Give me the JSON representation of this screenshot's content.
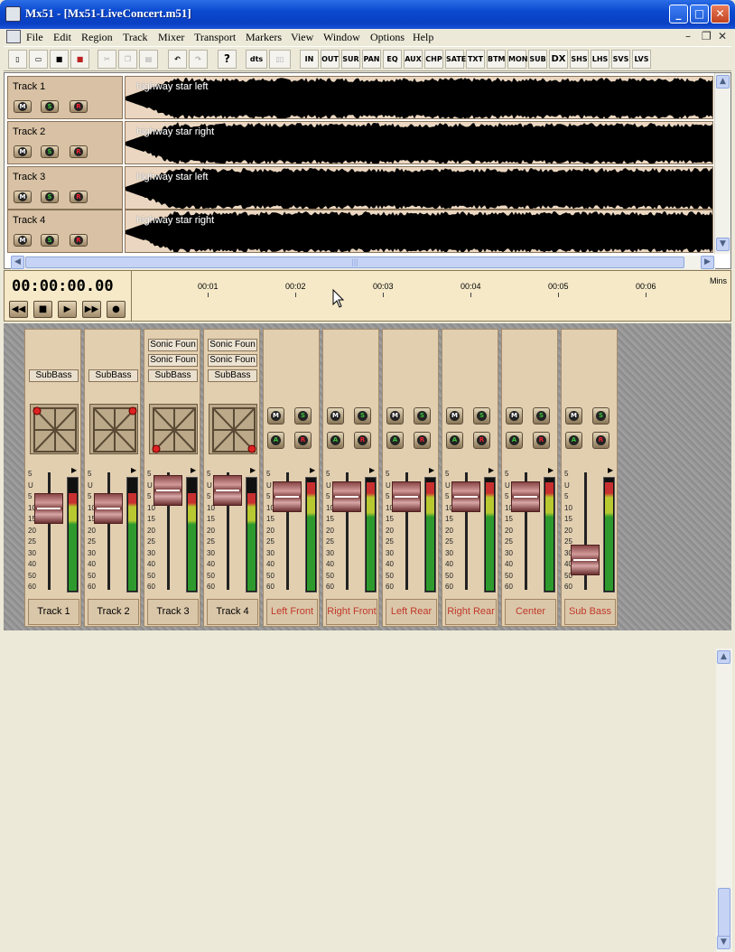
{
  "window": {
    "title": "Mx51 - [Mx51-LiveConcert.m51]"
  },
  "menu": [
    "File",
    "Edit",
    "Region",
    "Track",
    "Mixer",
    "Transport",
    "Markers",
    "View",
    "Window",
    "Options",
    "Help"
  ],
  "toolbar": {
    "buttons": [
      "new",
      "open",
      "save",
      "save-as",
      "cut",
      "copy",
      "paste",
      "undo",
      "redo",
      "help"
    ],
    "dts": "dts",
    "mixer_buttons": [
      "IN",
      "OUT",
      "SUR",
      "PAN",
      "EQ",
      "AUX",
      "CHP",
      "SATE",
      "TXT",
      "BTM",
      "MON",
      "SUB",
      "DX",
      "SHS",
      "LHS",
      "SVS",
      "LVS"
    ]
  },
  "tracks": [
    {
      "name": "Track 1",
      "clip": "highway star left",
      "buttons": {
        "m": "M",
        "s": "S",
        "r": "R"
      }
    },
    {
      "name": "Track 2",
      "clip": "highway star right",
      "buttons": {
        "m": "M",
        "s": "S",
        "r": "R"
      }
    },
    {
      "name": "Track 3",
      "clip": "highway star left",
      "buttons": {
        "m": "M",
        "s": "S",
        "r": "R"
      }
    },
    {
      "name": "Track 4",
      "clip": "highway star right",
      "buttons": {
        "m": "M",
        "s": "S",
        "r": "R"
      }
    }
  ],
  "transport": {
    "timecode": "00:00:00.00",
    "ruler": [
      "00:01",
      "00:02",
      "00:03",
      "00:04",
      "00:05",
      "00:06"
    ],
    "units": "Mins"
  },
  "mixer": {
    "scale": [
      "5",
      "U",
      "5",
      "10",
      "15",
      "20",
      "25",
      "30",
      "40",
      "50",
      "60"
    ],
    "strips": [
      {
        "name": "Track 1",
        "plugins": [],
        "sub": "SubBass",
        "type": "track",
        "fader": 0.72,
        "meter": 0.86
      },
      {
        "name": "Track 2",
        "plugins": [],
        "sub": "SubBass",
        "type": "track",
        "fader": 0.72,
        "meter": 0.86
      },
      {
        "name": "Track 3",
        "plugins": [
          "Sonic Foun",
          "Sonic Foun"
        ],
        "sub": "SubBass",
        "type": "track",
        "fader": 0.92,
        "meter": 0.86
      },
      {
        "name": "Track 4",
        "plugins": [
          "Sonic Foun",
          "Sonic Foun"
        ],
        "sub": "SubBass",
        "type": "track",
        "fader": 0.92,
        "meter": 0.86
      },
      {
        "name": "Left Front",
        "type": "bus",
        "fader": 0.85,
        "meter": 0.95,
        "labels": {
          "m": "M",
          "s": "S",
          "a": "A",
          "r": "R"
        }
      },
      {
        "name": "Right Front",
        "type": "bus",
        "fader": 0.85,
        "meter": 0.95,
        "labels": {
          "m": "M",
          "s": "S",
          "a": "A",
          "r": "R"
        }
      },
      {
        "name": "Left Rear",
        "type": "bus",
        "fader": 0.85,
        "meter": 0.95,
        "labels": {
          "m": "M",
          "s": "S",
          "a": "A",
          "r": "R"
        }
      },
      {
        "name": "Right Rear",
        "type": "bus",
        "fader": 0.85,
        "meter": 0.95,
        "labels": {
          "m": "M",
          "s": "S",
          "a": "A",
          "r": "R"
        }
      },
      {
        "name": "Center",
        "type": "bus",
        "fader": 0.85,
        "meter": 0.95,
        "labels": {
          "m": "M",
          "s": "S",
          "a": "A",
          "r": "R"
        }
      },
      {
        "name": "Sub Bass",
        "type": "bus",
        "fader": 0.15,
        "meter": 0.95,
        "labels": {
          "m": "M",
          "s": "S",
          "a": "A",
          "r": "R"
        }
      }
    ]
  }
}
